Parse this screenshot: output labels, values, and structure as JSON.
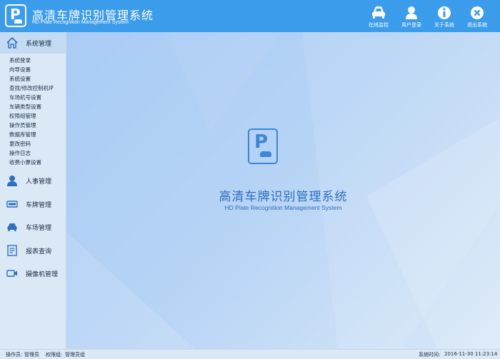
{
  "header": {
    "title": "高清车牌识别管理系统",
    "subtitle": "HD Plate Recognition Management System",
    "buttons": [
      {
        "label": "在线监控",
        "icon": "car-icon"
      },
      {
        "label": "用户登录",
        "icon": "user-icon"
      },
      {
        "label": "关于系统",
        "icon": "info-icon"
      },
      {
        "label": "退出系统",
        "icon": "close-icon"
      }
    ]
  },
  "sidebar": {
    "active_section": {
      "label": "系统管理",
      "icon": "home-icon"
    },
    "subitems": [
      "系统登录",
      "向导设置",
      "系统设置",
      "查找/修改控制机IP",
      "车场机号设置",
      "车辆类型设置",
      "权限组管理",
      "操作员管理",
      "数据库管理",
      "更改密码",
      "操作日志",
      "收费小票设置"
    ],
    "sections": [
      {
        "label": "人事管理",
        "icon": "person-icon"
      },
      {
        "label": "车牌管理",
        "icon": "plate-icon"
      },
      {
        "label": "车场管理",
        "icon": "car-icon"
      },
      {
        "label": "报表查询",
        "icon": "report-icon"
      },
      {
        "label": "摄像机管理",
        "icon": "camera-icon"
      }
    ]
  },
  "main": {
    "title": "高清车牌识别管理系统",
    "subtitle": "HD Plate Recognition Management System"
  },
  "status": {
    "operator_label": "操作员:",
    "operator_value": "管理员",
    "group_label": "权限组:",
    "group_value": "管理员组",
    "time_label": "系统时间:",
    "time_value": "2016-11-30 11:23:14"
  },
  "colors": {
    "header": "#3b9cec",
    "accent": "#2f6fc0",
    "sidebar": "#dbe9f6"
  }
}
